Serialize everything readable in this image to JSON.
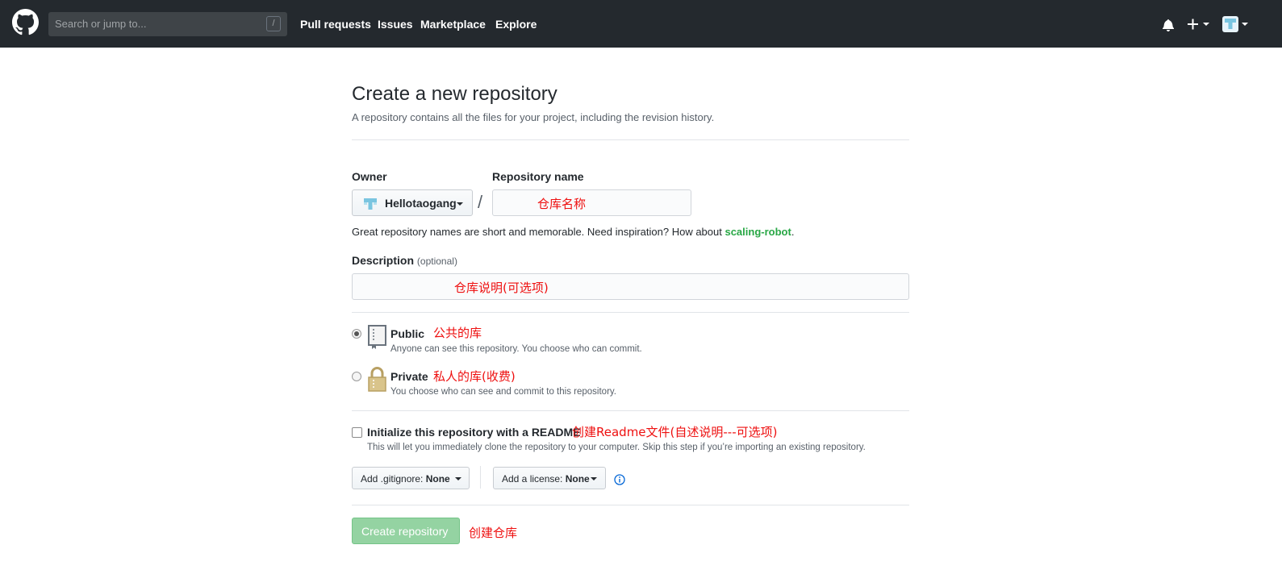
{
  "header": {
    "search_placeholder": "Search or jump to...",
    "search_shortcut": "/",
    "nav": [
      "Pull requests",
      "Issues",
      "Marketplace",
      "Explore"
    ],
    "bg_color": "#24292e"
  },
  "page": {
    "title": "Create a new repository",
    "subtitle": "A repository contains all the files for your project, including the revision history."
  },
  "form": {
    "owner_label": "Owner",
    "owner_value": "Hellotaogang",
    "repo_name_label": "Repository name",
    "slash": "/",
    "name_hint_prefix": "Great repository names are short and memorable. Need inspiration? How about ",
    "name_suggestion": "scaling-robot",
    "name_hint_suffix": ".",
    "description_label": "Description",
    "description_optional": "(optional)",
    "visibility": {
      "selected": "public",
      "public_label": "Public",
      "public_note": "Anyone can see this repository. You choose who can commit.",
      "private_label": "Private",
      "private_note": "You choose who can see and commit to this repository."
    },
    "readme_label": "Initialize this repository with a README",
    "readme_note": "This will let you immediately clone the repository to your computer. Skip this step if you’re importing an existing repository.",
    "readme_checked": false,
    "gitignore_prefix": "Add .gitignore: ",
    "gitignore_value": "None",
    "license_prefix": "Add a license: ",
    "license_value": "None",
    "submit_label": "Create repository",
    "submit_color": "#94d3a2"
  },
  "annotations": {
    "repo_name": "仓库名称",
    "description": "仓库说明(可选项)",
    "public": "公共的库",
    "private": "私人的库(收费)",
    "readme": "创建Readme文件(自述说明---可选项)",
    "create": "创建仓库",
    "color": "#ee1010"
  }
}
